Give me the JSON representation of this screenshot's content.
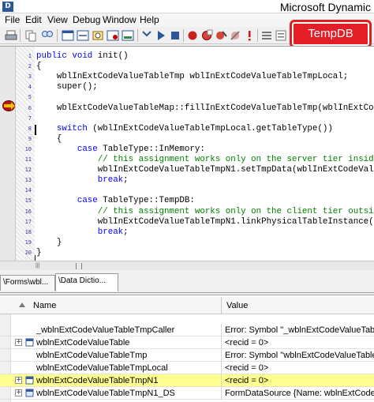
{
  "window": {
    "title": "Microsoft Dynamic",
    "app_icon_glyph": "D"
  },
  "menu": [
    "File",
    "Edit",
    "View",
    "Debug",
    "Window",
    "Help"
  ],
  "callout": {
    "text": "TempDB",
    "color": "#e41e26"
  },
  "editor": {
    "line_numbers": [
      "1",
      "2",
      "3",
      "4",
      "5",
      "6",
      "7",
      "8",
      "9",
      "10",
      "11",
      "12",
      "13",
      "14",
      "15",
      "16",
      "17",
      "18",
      "19",
      "20"
    ],
    "lines": [
      [
        {
          "t": "public void ",
          "c": "kw"
        },
        {
          "t": "init()",
          "c": ""
        }
      ],
      [
        {
          "t": "{",
          "c": ""
        }
      ],
      [
        {
          "t": "    wblInExtCodeValueTableTmp wblInExtCodeValueTableTmpLocal;",
          "c": ""
        }
      ],
      [
        {
          "t": "    super();",
          "c": ""
        }
      ],
      [
        {
          "t": "",
          "c": ""
        }
      ],
      [
        {
          "t": "    wblExtCodeValueTableMap::fillInExtCodeValueTableTmp(wblInExtCodeV",
          "c": ""
        }
      ],
      [
        {
          "t": "",
          "c": ""
        }
      ],
      [
        {
          "t": "    ",
          "c": ""
        },
        {
          "t": "switch",
          "c": "kw"
        },
        {
          "t": " (wblInExtCodeValueTableTmpLocal.getTableType())",
          "c": ""
        }
      ],
      [
        {
          "t": "    {",
          "c": ""
        }
      ],
      [
        {
          "t": "        ",
          "c": ""
        },
        {
          "t": "case",
          "c": "kw"
        },
        {
          "t": " TableType::InMemory:",
          "c": ""
        }
      ],
      [
        {
          "t": "            // this assignment works only on the server tier insid",
          "c": "cm"
        }
      ],
      [
        {
          "t": "            wblInExtCodeValueTableTmpN1.setTmpData(wblInExtCodeVal",
          "c": ""
        }
      ],
      [
        {
          "t": "            ",
          "c": ""
        },
        {
          "t": "break",
          "c": "kw"
        },
        {
          "t": ";",
          "c": ""
        }
      ],
      [
        {
          "t": "",
          "c": ""
        }
      ],
      [
        {
          "t": "        ",
          "c": ""
        },
        {
          "t": "case",
          "c": "kw"
        },
        {
          "t": " TableType::TempDB:",
          "c": ""
        }
      ],
      [
        {
          "t": "            // this assignment works only on the client tier outsi",
          "c": "cm"
        }
      ],
      [
        {
          "t": "            wblInExtCodeValueTableTmpN1.linkPhysicalTableInstance(",
          "c": ""
        }
      ],
      [
        {
          "t": "            ",
          "c": ""
        },
        {
          "t": "break",
          "c": "kw"
        },
        {
          "t": ";",
          "c": ""
        }
      ],
      [
        {
          "t": "    }",
          "c": ""
        }
      ],
      [
        {
          "t": "}",
          "c": ""
        }
      ]
    ]
  },
  "scrollbar": {
    "glyph": "|||"
  },
  "tabs": [
    {
      "label": "\\Forms\\wbl...",
      "active": false
    },
    {
      "label": "\\Data Dictio...",
      "active": true
    }
  ],
  "grid": {
    "columns": {
      "name": "Name",
      "value": "Value"
    },
    "rows": [
      {
        "name": "_wblnExtCodeValueTableTmpCaller",
        "value": "Error: Symbol \"_wblnExtCodeValueTabl",
        "expandable": false,
        "icon": "none",
        "highlight": false
      },
      {
        "name": "wblnExtCodeValueTable",
        "value": "<recid = 0>",
        "expandable": true,
        "icon": "table-icon",
        "highlight": false
      },
      {
        "name": "wblnExtCodeValueTableTmp",
        "value": "Error: Symbol \"wblnExtCodeValueTable",
        "expandable": false,
        "icon": "none",
        "highlight": false
      },
      {
        "name": "wblnExtCodeValueTableTmpLocal",
        "value": "<recid = 0>",
        "expandable": false,
        "icon": "none",
        "highlight": false
      },
      {
        "name": "wblnExtCodeValueTableTmpN1",
        "value": "<recid = 0>",
        "expandable": true,
        "icon": "table-icon",
        "highlight": true
      },
      {
        "name": "wblnExtCodeValueTableTmpN1_DS",
        "value": "FormDataSource {Name: wblnExtCodeV",
        "expandable": true,
        "icon": "datasource-icon",
        "highlight": false
      }
    ]
  }
}
